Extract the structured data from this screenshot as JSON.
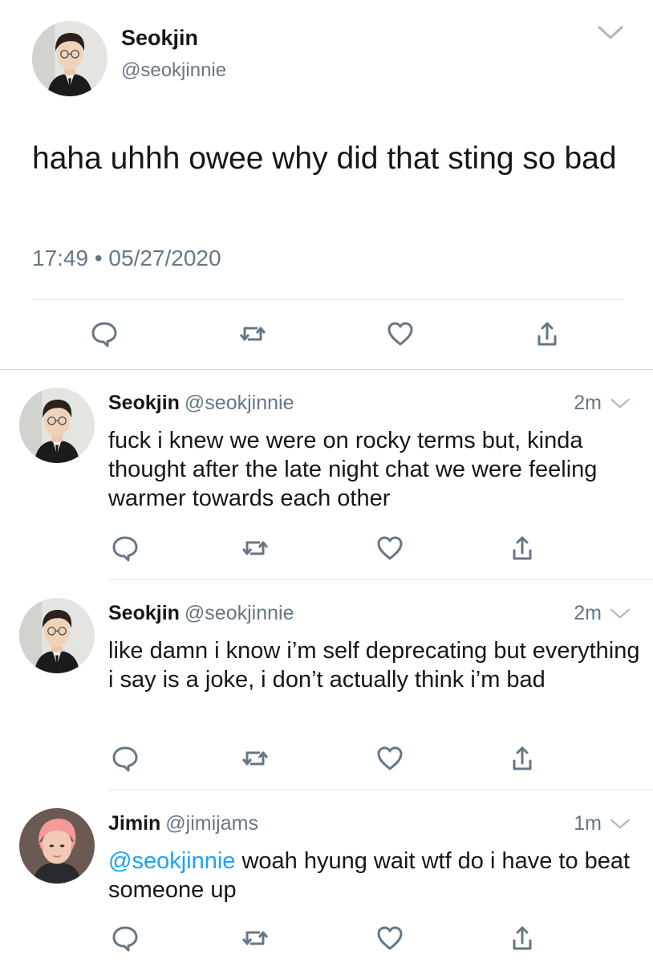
{
  "main_tweet": {
    "name": "Seokjin",
    "handle": "@seokjinnie",
    "text": "haha uhhh owee why did that sting so bad",
    "timestamp": "17:49 • 05/27/2020"
  },
  "replies": [
    {
      "name": "Seokjin",
      "handle": "@seokjinnie",
      "time": "2m",
      "text": "fuck i knew we were on rocky terms but, kinda thought after the late night chat we were feeling warmer towards each other"
    },
    {
      "name": "Seokjin",
      "handle": "@seokjinnie",
      "time": "2m",
      "text": "like damn i know i’m self deprecating but everything i say is a joke, i don’t actually think i’m bad"
    },
    {
      "name": "Jimin",
      "handle": "@jimijams",
      "time": "1m",
      "mention": "@seokjinnie",
      "text": " woah hyung wait wtf do i have to beat someone up"
    }
  ],
  "icons": {
    "reply": "reply-icon",
    "retweet": "retweet-icon",
    "like": "heart-icon",
    "share": "share-icon",
    "more": "chevron-down-icon"
  },
  "colors": {
    "text": "#14171a",
    "secondary": "#657786",
    "link": "#1da1f2",
    "divider": "#e1e8ed"
  }
}
